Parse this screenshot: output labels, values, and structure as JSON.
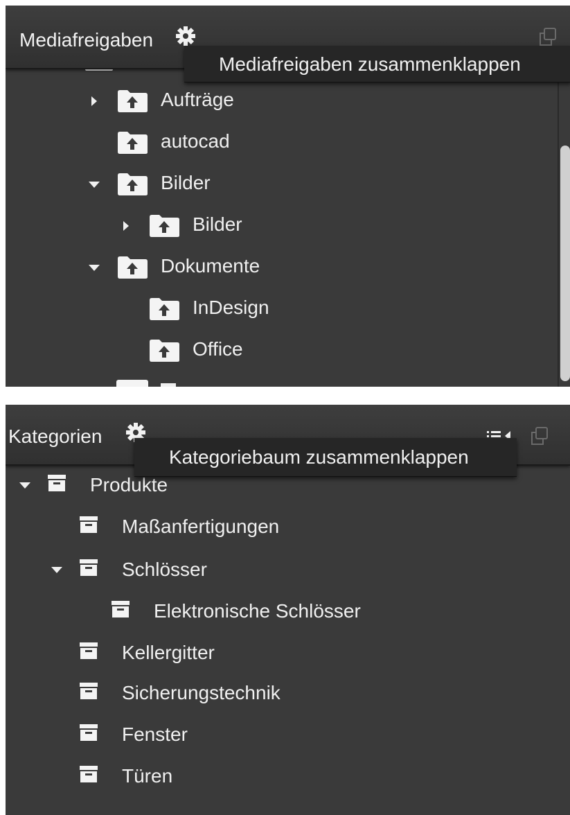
{
  "media_panel": {
    "title": "Mediafreigaben",
    "tooltip": "Mediafreigaben zusammenklappen",
    "items": [
      {
        "label": "Aufträge",
        "state": "collapsed",
        "icon": "folder-upload-icon"
      },
      {
        "label": "autocad",
        "state": "leaf",
        "icon": "folder-upload-icon"
      },
      {
        "label": "Bilder",
        "state": "expanded",
        "icon": "folder-upload-icon"
      },
      {
        "label": "Bilder",
        "state": "collapsed",
        "icon": "folder-upload-icon"
      },
      {
        "label": "Dokumente",
        "state": "expanded",
        "icon": "folder-upload-icon"
      },
      {
        "label": "InDesign",
        "state": "leaf",
        "icon": "folder-upload-icon"
      },
      {
        "label": "Office",
        "state": "leaf",
        "icon": "folder-upload-icon"
      }
    ]
  },
  "category_panel": {
    "title": "Kategorien",
    "tooltip": "Kategoriebaum zusammenklappen",
    "items": [
      {
        "label": "Produkte",
        "state": "expanded",
        "icon": "archive-box-icon"
      },
      {
        "label": "Maßanfertigungen",
        "state": "leaf",
        "icon": "archive-box-icon"
      },
      {
        "label": "Schlösser",
        "state": "expanded",
        "icon": "archive-box-icon"
      },
      {
        "label": "Elektronische Schlösser",
        "state": "leaf",
        "icon": "archive-box-icon"
      },
      {
        "label": "Kellergitter",
        "state": "leaf",
        "icon": "archive-box-icon"
      },
      {
        "label": "Sicherungstechnik",
        "state": "leaf",
        "icon": "archive-box-icon"
      },
      {
        "label": "Fenster",
        "state": "leaf",
        "icon": "archive-box-icon"
      },
      {
        "label": "Türen",
        "state": "leaf",
        "icon": "archive-box-icon"
      }
    ]
  },
  "colors": {
    "panel_bg": "#3a3a3a",
    "header_bg": "#333333",
    "tooltip_bg": "#262626",
    "text": "#f0f0f0"
  }
}
